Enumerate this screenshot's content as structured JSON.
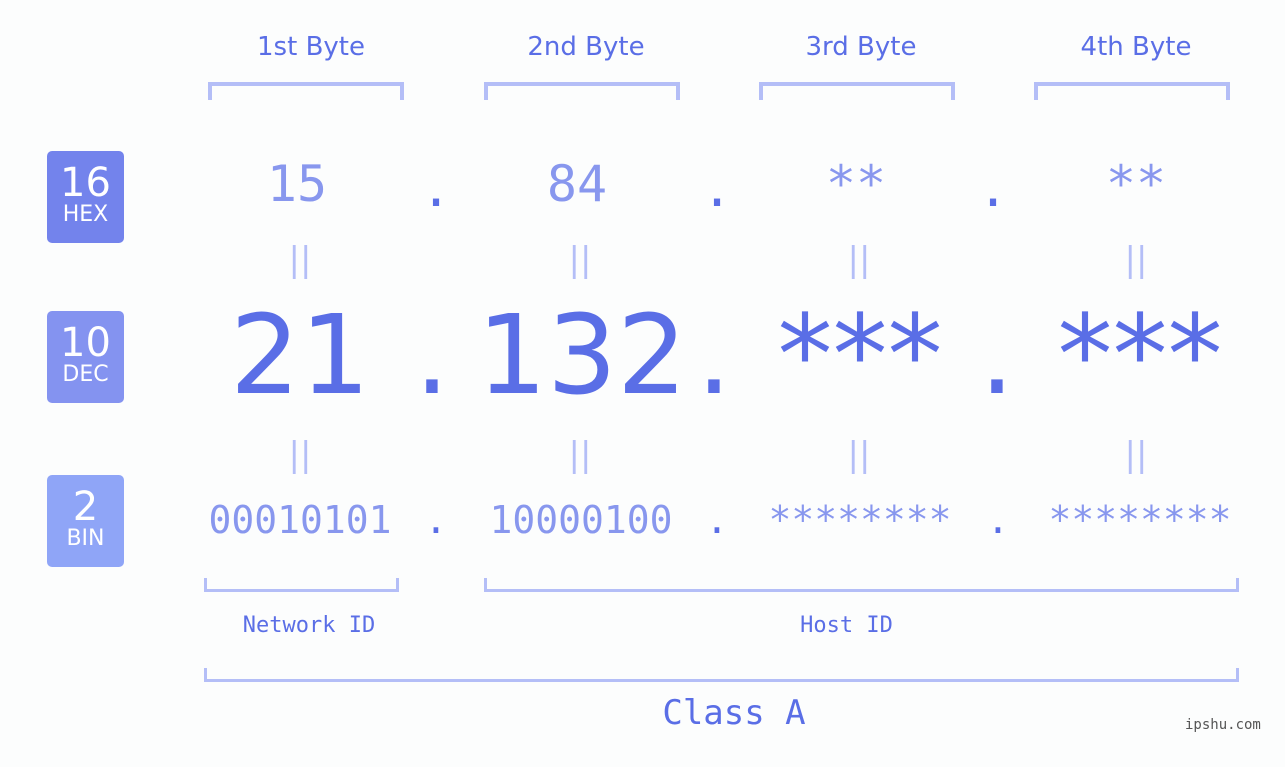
{
  "bytes": [
    {
      "header": "1st Byte",
      "hex": "15",
      "dec": "21",
      "bin": "00010101"
    },
    {
      "header": "2nd Byte",
      "hex": "84",
      "dec": "132",
      "bin": "10000100"
    },
    {
      "header": "3rd Byte",
      "hex": "**",
      "dec": "***",
      "bin": "********"
    },
    {
      "header": "4th Byte",
      "hex": "**",
      "dec": "***",
      "bin": "********"
    }
  ],
  "badges": [
    {
      "base": "16",
      "label": "HEX",
      "color": "#7383ec"
    },
    {
      "base": "10",
      "label": "DEC",
      "color": "#8493f0"
    },
    {
      "base": "2",
      "label": "BIN",
      "color": "#8fa5f7"
    }
  ],
  "separator": ".",
  "equals": "||",
  "network_label": "Network ID",
  "host_label": "Host ID",
  "class_label": "Class A",
  "watermark": "ipshu.com",
  "colors": {
    "primary": "#5a6ee6",
    "light": "#8897ee",
    "bracket": "#b4bef7"
  }
}
